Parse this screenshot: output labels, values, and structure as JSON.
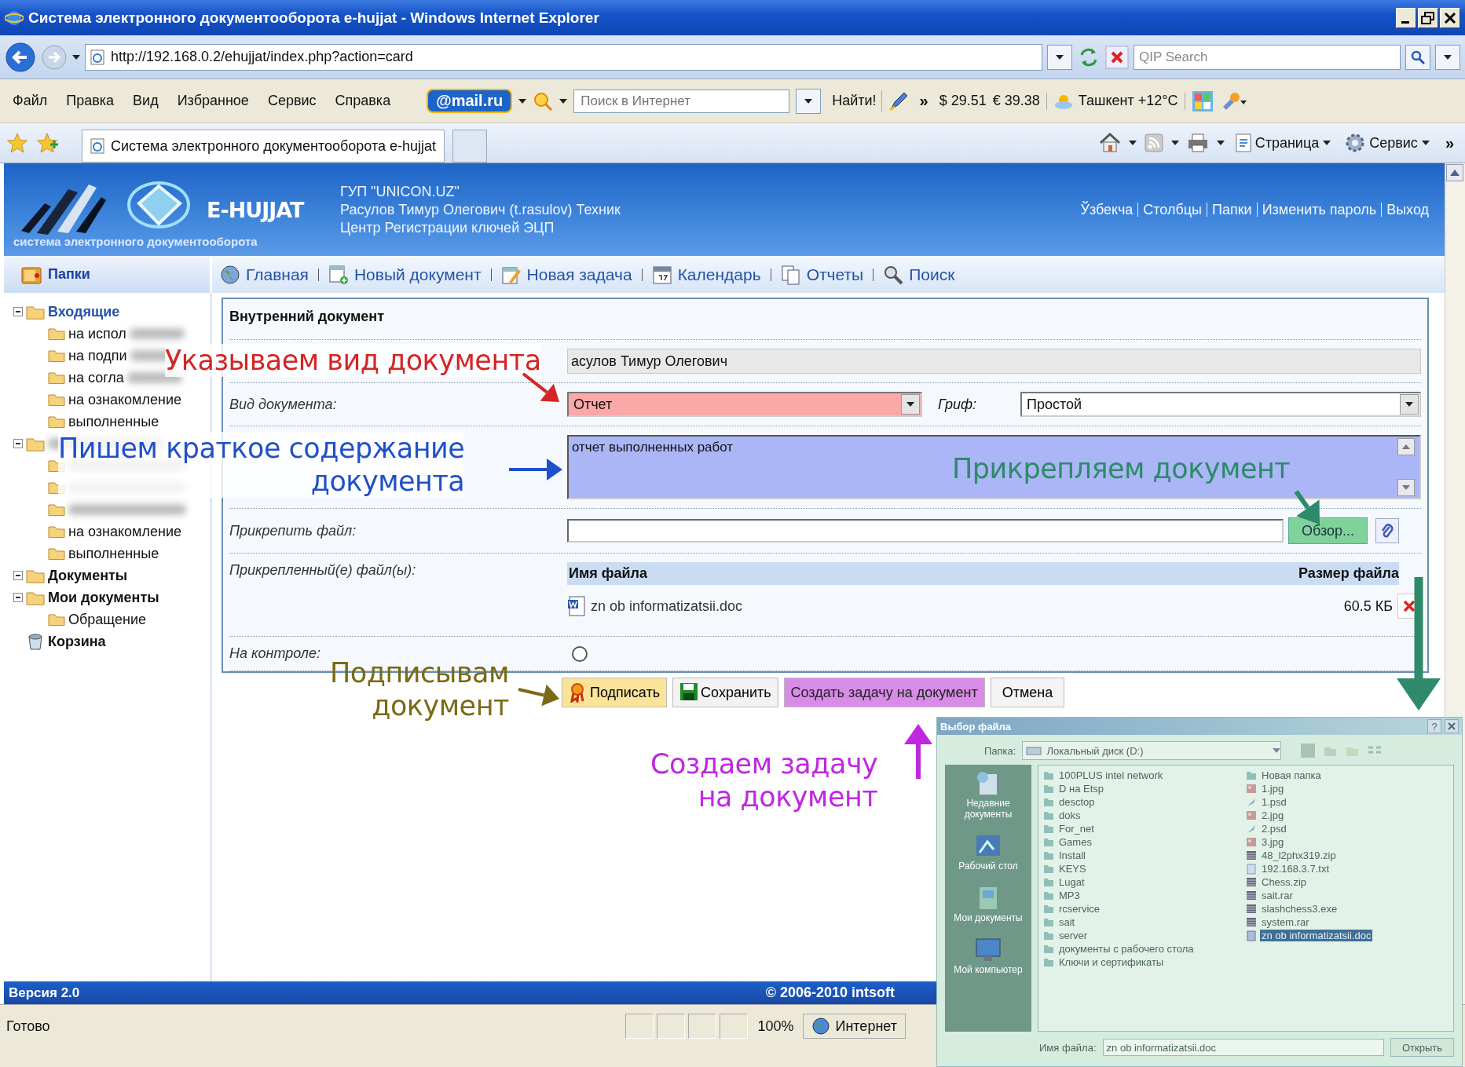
{
  "browser": {
    "title": "Система электронного документооборота e-hujjat - Windows Internet Explorer",
    "address": "http://192.168.0.2/ehujjat/index.php?action=card",
    "search": {
      "placeholder": "QIP Search"
    },
    "menu": [
      "Файл",
      "Правка",
      "Вид",
      "Избранное",
      "Сервис",
      "Справка"
    ],
    "mail_logo": "@mail.ru",
    "web_search": {
      "placeholder": "Поиск в Интернет"
    },
    "find_button": "Найти!",
    "more": "»",
    "rates": [
      "$ 29.51",
      "€ 39.38"
    ],
    "weather": "Ташкент +12°C",
    "tab": {
      "label": "Система электронного документооборота e-hujjat",
      "selected": true
    },
    "command_bar": [
      "Страница",
      "Сервис"
    ],
    "command_more": "»"
  },
  "app": {
    "logo": {
      "name": "E-HUJJAT",
      "tagline": "система электронного документооборота"
    },
    "user_lines": [
      "ГУП \"UNICON.UZ\"",
      "Расулов Тимур Олегович (t.rasulov) Техник",
      "Центр Регистрации ключей ЭЦП"
    ],
    "top_links": [
      "Ўзбекча",
      "Столбцы",
      "Папки",
      "Изменить пароль",
      "Выход"
    ],
    "folders_title": "Папки",
    "nav": [
      {
        "label": "Главная",
        "kind": "home"
      },
      {
        "label": "Новый документ",
        "kind": "new_document"
      },
      {
        "label": "Новая задача",
        "kind": "new_task"
      },
      {
        "label": "Календарь",
        "kind": "calendar"
      },
      {
        "label": "Отчеты",
        "kind": "reports"
      },
      {
        "label": "Поиск",
        "kind": "search"
      }
    ],
    "tree": [
      {
        "label": "Входящие",
        "kind": "folder",
        "expanded": true,
        "children": [
          {
            "label": "на испол",
            "kind": "folder",
            "blurred": true
          },
          {
            "label": "на подпи",
            "kind": "folder",
            "blurred": true
          },
          {
            "label": "на согла",
            "kind": "folder",
            "blurred": true
          },
          {
            "label": "на ознакомление",
            "kind": "folder",
            "blurred": false
          },
          {
            "label": "выполненные",
            "kind": "folder",
            "blurred": false
          }
        ]
      },
      {
        "kind": "folder",
        "expanded": true,
        "blurred": true,
        "children": [
          {
            "kind": "folder",
            "blurred": true
          },
          {
            "kind": "folder",
            "blurred": true
          },
          {
            "kind": "folder",
            "blurred": true
          },
          {
            "label": "на ознакомление",
            "kind": "folder",
            "blurred": false
          },
          {
            "label": "выполненные",
            "kind": "folder",
            "blurred": false
          }
        ]
      },
      {
        "label": "Документы",
        "kind": "folder",
        "expanded": true
      },
      {
        "label": "Мои документы",
        "kind": "folder",
        "expanded": true,
        "children": [
          {
            "label": "Обращение",
            "kind": "folder",
            "blurred": false
          }
        ]
      },
      {
        "label": "Корзина",
        "kind": "trash"
      }
    ],
    "form": {
      "title": "Внутренний документ",
      "author": "асулов Тимур Олегович",
      "doc_type": {
        "label": "Вид документа:",
        "value": "Отчет"
      },
      "stamp": {
        "label": "Гриф:",
        "value": "Простой"
      },
      "summary": "отчет выполненных работ",
      "attach": {
        "label": "Прикрепить файл:",
        "browse_button": "Обзор..."
      },
      "attached": {
        "label": "Прикрепленный(е) файл(ы):",
        "columns": [
          "Имя файла",
          "Размер файла"
        ],
        "rows": [
          {
            "name": "zn ob informatizatsii.doc",
            "size": "60.5 КБ"
          }
        ]
      },
      "control": {
        "label": "На контроле:",
        "checked": false
      },
      "buttons": [
        {
          "label": "Подписать",
          "kind": "sign"
        },
        {
          "label": "Сохранить",
          "kind": "save"
        },
        {
          "label": "Создать задачу на документ",
          "kind": "task"
        },
        {
          "label": "Отмена",
          "kind": "cancel"
        }
      ]
    },
    "footer": {
      "version": "Версия 2.0",
      "copyright": "© 2006-2010 intsoft"
    }
  },
  "annotations": [
    {
      "lines": [
        "Указываем вид документа"
      ],
      "color": "#d42424"
    },
    {
      "lines": [
        "Пишем краткое содержание",
        "документа"
      ],
      "color": "#2050c8"
    },
    {
      "lines": [
        "Прикрепляем документ"
      ],
      "color": "#2e8a6a"
    },
    {
      "lines": [
        "Подписывам",
        "документ"
      ],
      "color": "#7a6a14"
    },
    {
      "lines": [
        "Создаем задачу",
        "на документ"
      ],
      "color": "#c028e0"
    }
  ],
  "file_dialog": {
    "title": "Выбор файла",
    "help": "?",
    "folder_label": "Папка:",
    "folder": "Локальный диск (D:)",
    "places": [
      "Недавние документы",
      "Рабочий стол",
      "Мои документы",
      "Мой компьютер"
    ],
    "files": [
      {
        "name": "100PLUS intel network",
        "kind": "folder",
        "selected": false
      },
      {
        "name": "D на Etsp",
        "kind": "folder",
        "selected": false
      },
      {
        "name": "desctop",
        "kind": "folder",
        "selected": false
      },
      {
        "name": "doks",
        "kind": "folder",
        "selected": false
      },
      {
        "name": "For_net",
        "kind": "folder",
        "selected": false
      },
      {
        "name": "Games",
        "kind": "folder",
        "selected": false
      },
      {
        "name": "Install",
        "kind": "folder",
        "selected": false
      },
      {
        "name": "KEYS",
        "kind": "folder",
        "selected": false
      },
      {
        "name": "Lugat",
        "kind": "folder",
        "selected": false
      },
      {
        "name": "MP3",
        "kind": "folder",
        "selected": false
      },
      {
        "name": "rcservice",
        "kind": "folder",
        "selected": false
      },
      {
        "name": "sait",
        "kind": "folder",
        "selected": false
      },
      {
        "name": "server",
        "kind": "folder",
        "selected": false
      },
      {
        "name": "документы с рабочего стола",
        "kind": "folder",
        "selected": false
      },
      {
        "name": "Ключи и сертификаты",
        "kind": "folder",
        "selected": false
      },
      {
        "name": "Новая папка",
        "kind": "folder",
        "selected": false
      },
      {
        "name": "1.jpg",
        "kind": "image",
        "selected": false
      },
      {
        "name": "1.psd",
        "kind": "psd",
        "selected": false
      },
      {
        "name": "2.jpg",
        "kind": "image",
        "selected": false
      },
      {
        "name": "2.psd",
        "kind": "psd",
        "selected": false
      },
      {
        "name": "3.jpg",
        "kind": "image",
        "selected": false
      },
      {
        "name": "48_l2phx319.zip",
        "kind": "archive",
        "selected": false
      },
      {
        "name": "192.168.3.7.txt",
        "kind": "text",
        "selected": false
      },
      {
        "name": "Chess.zip",
        "kind": "archive",
        "selected": false
      },
      {
        "name": "sait.rar",
        "kind": "archive",
        "selected": false
      },
      {
        "name": "slashchess3.exe",
        "kind": "archive",
        "selected": false
      },
      {
        "name": "system.rar",
        "kind": "archive",
        "selected": false
      },
      {
        "name": "zn ob informatizatsii.doc",
        "kind": "doc",
        "selected": true
      }
    ],
    "filename_label": "Имя файла:",
    "filename": "zn ob informatizatsii.doc",
    "open_button": "Открыть"
  },
  "status_bar": {
    "text": "Готово",
    "zone": "Интернет",
    "zoom": "100%"
  }
}
